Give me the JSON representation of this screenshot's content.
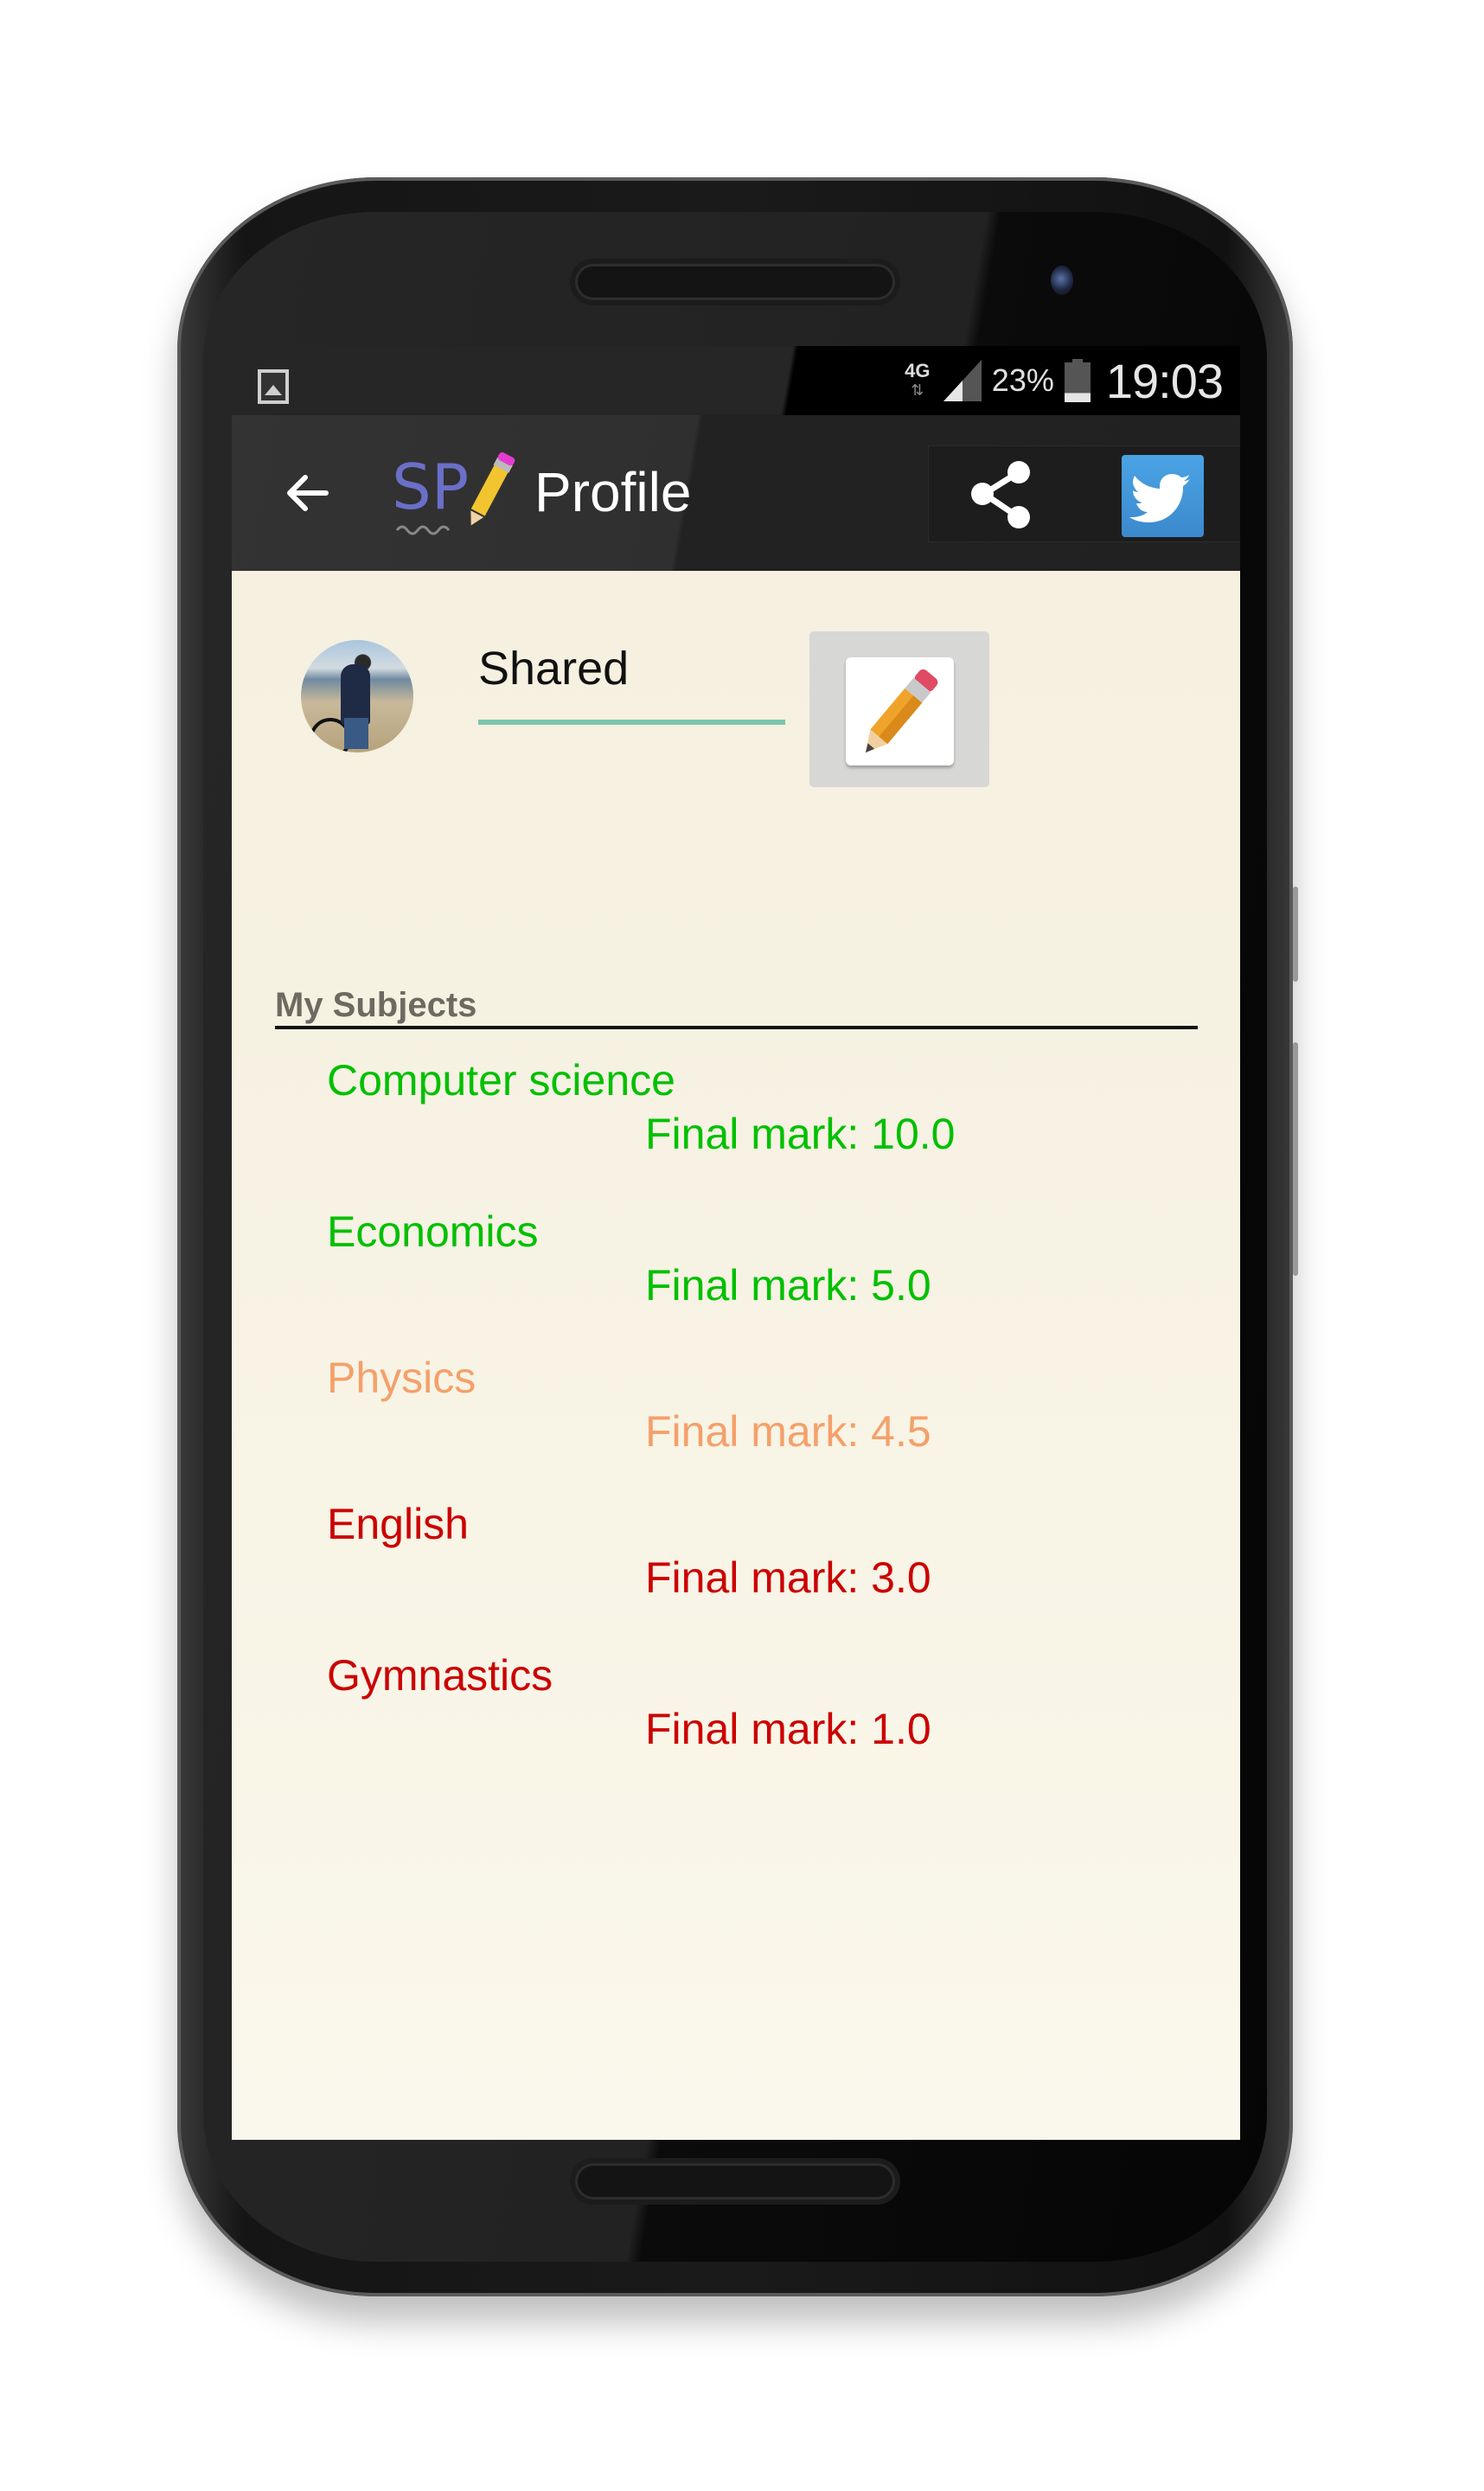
{
  "status_bar": {
    "network": "4G",
    "battery_percent": "23%",
    "battery_level": 0.23,
    "time": "19:03",
    "notification_icon": "gallery-icon"
  },
  "toolbar": {
    "back_icon": "arrow-left-icon",
    "logo_text": "SP",
    "title": "Profile",
    "share_icon": "share-icon",
    "twitter_icon": "twitter-icon"
  },
  "profile": {
    "name_value": "Shared",
    "edit_icon": "pencil-icon"
  },
  "subjects_section": {
    "title": "My Subjects",
    "items": [
      {
        "name": "Computer science",
        "mark_label": "Final mark: 10.0",
        "color": "#00c000"
      },
      {
        "name": "Economics",
        "mark_label": "Final mark: 5.0",
        "color": "#00c000"
      },
      {
        "name": "Physics",
        "mark_label": "Final mark: 4.5",
        "color": "#f5a06a"
      },
      {
        "name": "English",
        "mark_label": "Final mark: 3.0",
        "color": "#cc0000"
      },
      {
        "name": "Gymnastics",
        "mark_label": "Final mark: 1.0",
        "color": "#cc0000"
      }
    ]
  }
}
